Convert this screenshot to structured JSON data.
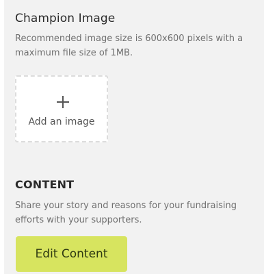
{
  "champion_image": {
    "title": "Champion Image",
    "description": "Recommended image size is 600x600 pixels with a maximum file size of 1MB.",
    "add_image_label": "Add an image",
    "add_icon": "plus-icon"
  },
  "content": {
    "title": "CONTENT",
    "description": "Share your story and reasons for your fundraising efforts with your supporters.",
    "edit_button_label": "Edit Content",
    "edit_button_color": "#d7e45f"
  },
  "colors": {
    "panel_background": "#f2f2f2",
    "title_text": "#2a2a2a",
    "description_text": "#6f6f6f"
  }
}
